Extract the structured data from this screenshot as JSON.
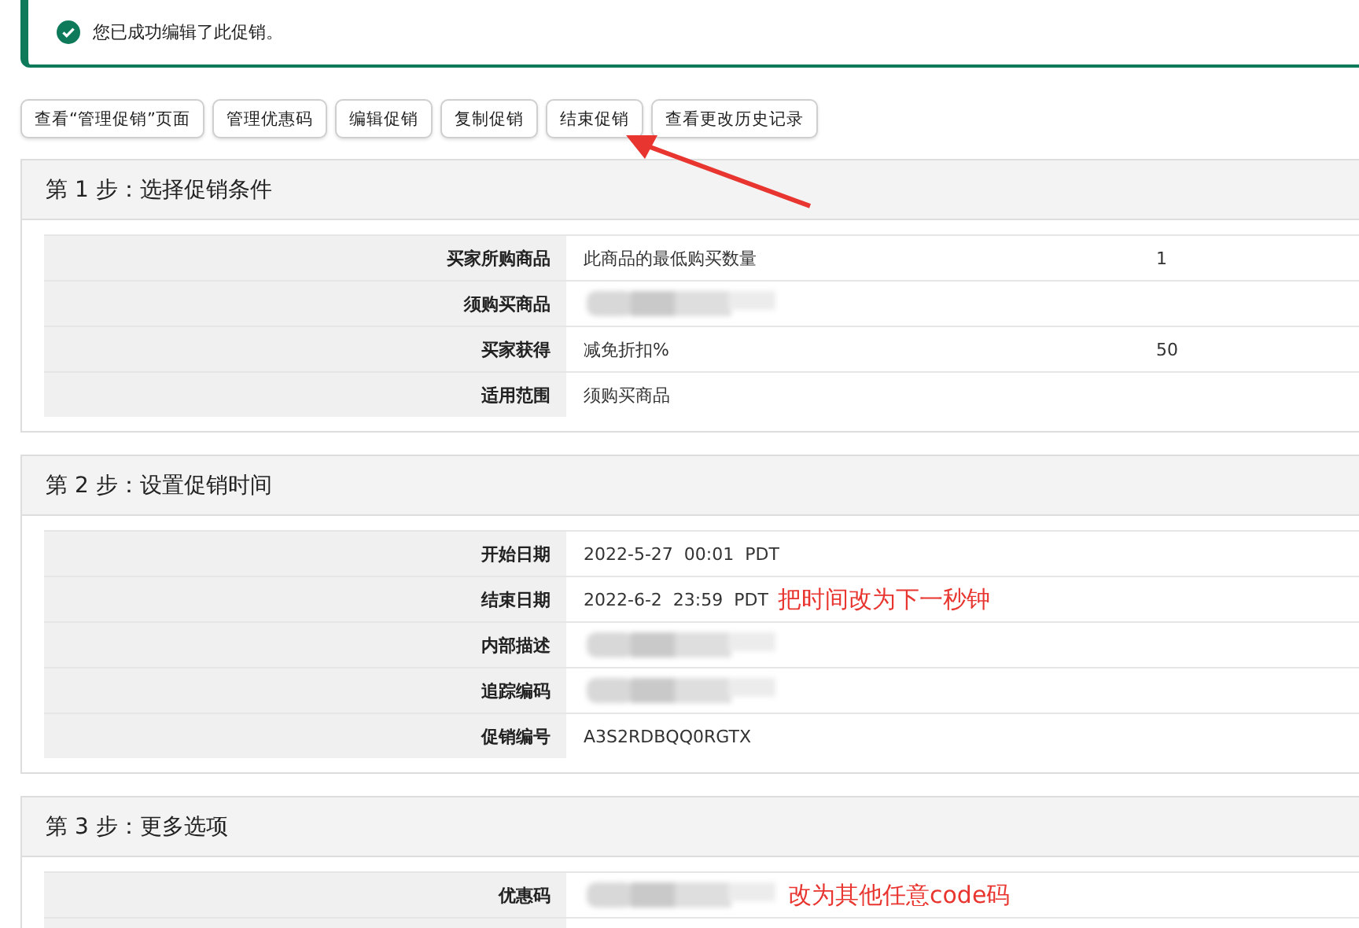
{
  "alert": {
    "message": "您已成功编辑了此促销。"
  },
  "buttons": [
    "查看“管理促销”页面",
    "管理优惠码",
    "编辑促销",
    "复制促销",
    "结束促销",
    "查看更改历史记录"
  ],
  "annotation_arrow": {
    "shown": true
  },
  "sections": [
    {
      "title": "第 1 步：选择促销条件",
      "rows": [
        {
          "kind": "text",
          "label": "买家所购商品",
          "value": "此商品的最低购买数量",
          "extra": "1"
        },
        {
          "kind": "redacted",
          "label": "须购买商品"
        },
        {
          "kind": "text",
          "label": "买家获得",
          "value": "减免折扣%",
          "extra": "50"
        },
        {
          "kind": "text",
          "label": "适用范围",
          "value": "须购买商品"
        }
      ]
    },
    {
      "title": "第 2 步：设置促销时间",
      "rows": [
        {
          "kind": "text",
          "label": "开始日期",
          "value": "2022-5-27  00:01  PDT"
        },
        {
          "kind": "text",
          "label": "结束日期",
          "value": "2022-6-2  23:59  PDT",
          "note": "把时间改为下一秒钟"
        },
        {
          "kind": "redacted",
          "label": "内部描述"
        },
        {
          "kind": "redacted",
          "label": "追踪编码"
        },
        {
          "kind": "text",
          "label": "促销编号",
          "value": "A3S2RDBQQ0RGTX"
        }
      ]
    },
    {
      "title": "第 3 步：更多选项",
      "rows": [
        {
          "kind": "redacted",
          "label": "优惠码",
          "note": "改为其他任意code码"
        },
        {
          "kind": "empty"
        }
      ]
    }
  ]
}
